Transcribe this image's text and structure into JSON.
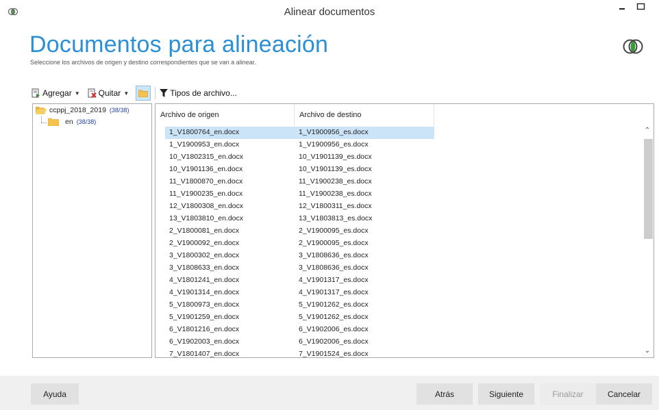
{
  "window": {
    "title": "Alinear documentos"
  },
  "header": {
    "title": "Documentos para alineación",
    "subtitle": "Seleccione los archivos de origen y destino correspondientes que se van a alinear."
  },
  "toolbar": {
    "add_label": "Agregar",
    "remove_label": "Quitar",
    "file_types_label": "Tipos de archivo..."
  },
  "tree": {
    "root": {
      "label": "ccppj_2018_2019",
      "count": "(38/38)"
    },
    "child": {
      "label": "en",
      "count": "(38/38)"
    }
  },
  "list": {
    "columns": [
      "Archivo de origen",
      "Archivo de destino"
    ],
    "rows": [
      [
        "1_V1800764_en.docx",
        "1_V1900956_es.docx"
      ],
      [
        "1_V1900953_en.docx",
        "1_V1900956_es.docx"
      ],
      [
        "10_V1802315_en.docx",
        "10_V1901139_es.docx"
      ],
      [
        "10_V1901136_en.docx",
        "10_V1901139_es.docx"
      ],
      [
        "11_V1800870_en.docx",
        "11_V1900238_es.docx"
      ],
      [
        "11_V1900235_en.docx",
        "11_V1900238_es.docx"
      ],
      [
        "12_V1800308_en.docx",
        "12_V1800311_es.docx"
      ],
      [
        "13_V1803810_en.docx",
        "13_V1803813_es.docx"
      ],
      [
        "2_V1800081_en.docx",
        "2_V1900095_es.docx"
      ],
      [
        "2_V1900092_en.docx",
        "2_V1900095_es.docx"
      ],
      [
        "3_V1800302_en.docx",
        "3_V1808636_es.docx"
      ],
      [
        "3_V1808633_en.docx",
        "3_V1808636_es.docx"
      ],
      [
        "4_V1801241_en.docx",
        "4_V1901317_es.docx"
      ],
      [
        "4_V1901314_en.docx",
        "4_V1901317_es.docx"
      ],
      [
        "5_V1800973_en.docx",
        "5_V1901262_es.docx"
      ],
      [
        "5_V1901259_en.docx",
        "5_V1901262_es.docx"
      ],
      [
        "6_V1801216_en.docx",
        "6_V1902006_es.docx"
      ],
      [
        "6_V1902003_en.docx",
        "6_V1902006_es.docx"
      ],
      [
        "7_V1801407_en.docx",
        "7_V1901524_es.docx"
      ]
    ],
    "selected_index": 0
  },
  "footer": {
    "help_label": "Ayuda",
    "back_label": "Atrás",
    "next_label": "Siguiente",
    "finish_label": "Finalizar",
    "cancel_label": "Cancelar"
  },
  "colors": {
    "accent": "#2b8fd6",
    "selection": "#cce4f7"
  }
}
